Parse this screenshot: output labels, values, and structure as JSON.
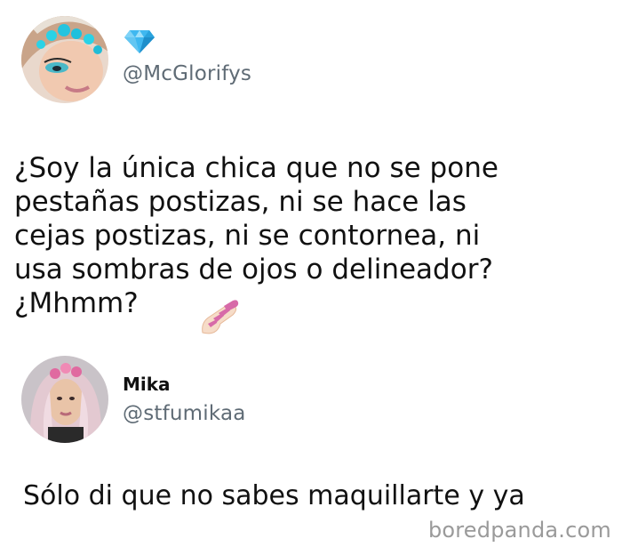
{
  "tweet": {
    "author_handle": "@McGlorifys",
    "badge_icon": "diamond-icon",
    "text_lines": [
      "¿Soy la única chica que no se pone",
      "pestañas postizas, ni se hace las",
      "cejas postizas, ni se contornea, ni",
      "usa sombras de ojos o delineador?",
      "¿Mhmm?"
    ],
    "trailing_emoji_icon": "nail-polish-icon"
  },
  "reply": {
    "display_name": "Mika",
    "handle": "@stfumikaa",
    "text": "Sólo di que no sabes maquillarte y ya"
  },
  "watermark": "boredpanda.com",
  "colors": {
    "handle_gray": "#5f6b75",
    "diamond_blue": "#3fb8f0",
    "nail_polish_pink": "#d76aa8",
    "watermark_gray": "#9a9a9a"
  }
}
